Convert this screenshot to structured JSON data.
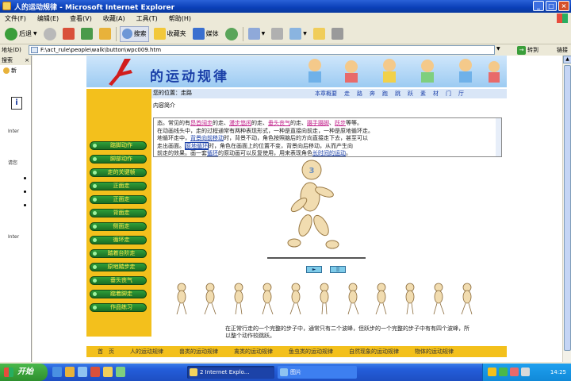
{
  "window": {
    "title": "人的运动规律 - Microsoft Internet Explorer"
  },
  "menu": [
    "文件(F)",
    "编辑(E)",
    "查看(V)",
    "收藏(A)",
    "工具(T)",
    "帮助(H)"
  ],
  "toolbar": {
    "back": "后退",
    "search": "搜索",
    "favorites": "收藏夹",
    "media": "媒体"
  },
  "address": {
    "label": "地址(D)",
    "value": "F:\\act_rule\\people\\walk\\button\\wpc009.htm",
    "go": "转到",
    "links": "链接"
  },
  "sidepane": {
    "title": "搜索",
    "new": "新",
    "inter1": "Inter",
    "text2": "请您",
    "inter2": "Inter"
  },
  "page": {
    "title": "的运动规律",
    "nav_links": [
      "本章概要",
      "走",
      "路",
      "奔",
      "跑",
      "跳",
      "跃",
      "素",
      "材",
      "门",
      "厅"
    ],
    "location": "您的位置：走路",
    "intro": "内容简介",
    "side_menu": [
      "踮脚动作",
      "脚部动作",
      "走的关键帧",
      "正面走",
      "正面走",
      "背面走",
      "侧面走",
      "循环走",
      "踏着台阶走",
      "原地踏步走",
      "垂头丧气",
      "踮着脚走",
      "作品练习"
    ],
    "text": {
      "line1": "态。常见的有",
      "hl1": "昂首阔步",
      "t1": "的走、",
      "hl2": "漫步悠闲",
      "t2": "的走、",
      "hl3": "垂头丧气",
      "t3": "的走、",
      "hl4": "蹑手蹑脚",
      "t4": "、",
      "hl5": "跃步",
      "t5": "等等。",
      "line2": "在动画线头中，走的过程通常有两种表现形式，一种是直接向前走，一种是原地循环走。",
      "line3_a": "地循环走中，",
      "blue1": "背景向前移动",
      "line3_b": "时，背景不动，角色按照脑后的方向直接走下去，甚至可以",
      "line4_a": "走出画面。",
      "blue2": "原地循环",
      "line4_b": "时，角色在画面上的位置不变，背景向后移动，从而产生向",
      "line5_a": "前走的效果。画一套",
      "blue3": "循环",
      "line5_b": "的原动画可以反复使用，用来表现角色",
      "blue4": "长时间的运动",
      "line5_c": "。"
    },
    "controls": {
      "play": "►",
      "pause": "||"
    },
    "caption": "在正常行走的一个完整的步子中，通常只有二个波峰，但跃步的一个完整的步子中有有四个波峰，所以整个动作较跳跃。",
    "footer": [
      "首　页",
      "人的运动规律",
      "兽类的运动规律",
      "禽类的运动规律",
      "鱼虫类的运动规律",
      "自然现象的运动规律",
      "物体的运动规律"
    ]
  },
  "taskbar": {
    "start": "开始",
    "tasks": [
      "2 Internet Explo...",
      "图片"
    ],
    "clock": "14:25"
  }
}
